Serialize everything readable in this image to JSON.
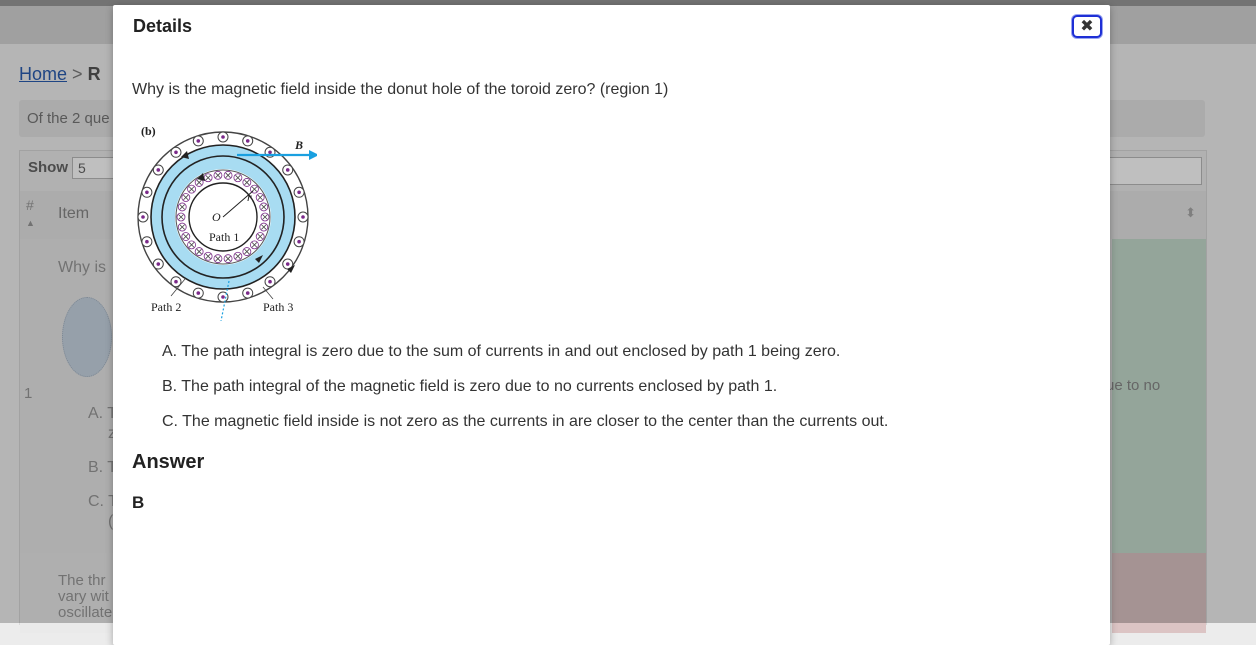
{
  "background": {
    "breadcrumb": {
      "home": "Home",
      "separator": ">",
      "current": "R"
    },
    "summary_text": "Of the 2 que",
    "table": {
      "show_label": "Show",
      "page_size": "5",
      "col_num": "#",
      "col_item": "Item",
      "row1": {
        "num": "1",
        "question": "Why is",
        "options": [
          "A. T",
          "z",
          "B. T",
          "C. T",
          "("
        ],
        "feedback_fragment": "ue to no"
      },
      "row2": {
        "lines": [
          "The thr",
          "vary wit",
          "oscillate"
        ]
      }
    }
  },
  "modal": {
    "title": "Details",
    "close_icon": "close-icon",
    "question": "Why is the magnetic field inside the donut hole of the toroid zero? (region 1)",
    "figure": {
      "panel_label": "(b)",
      "b_label": "B",
      "o_label": "O",
      "r_label": "r",
      "path1": "Path 1",
      "path2": "Path 2",
      "path3": "Path 3",
      "colors": {
        "field_band": "#a8dcf2",
        "arrow": "#1aa0e0",
        "current_dot": "#7b2a8a"
      }
    },
    "choices": [
      "A. The path integral is zero due to the sum of currents in and out enclosed by path 1 being zero.",
      "B. The path integral of the magnetic field is zero due to no currents enclosed by path 1.",
      "C. The magnetic field inside is not zero as the currents in are closer to the center than the currents out."
    ],
    "answer_heading": "Answer",
    "answer_value": "B"
  }
}
